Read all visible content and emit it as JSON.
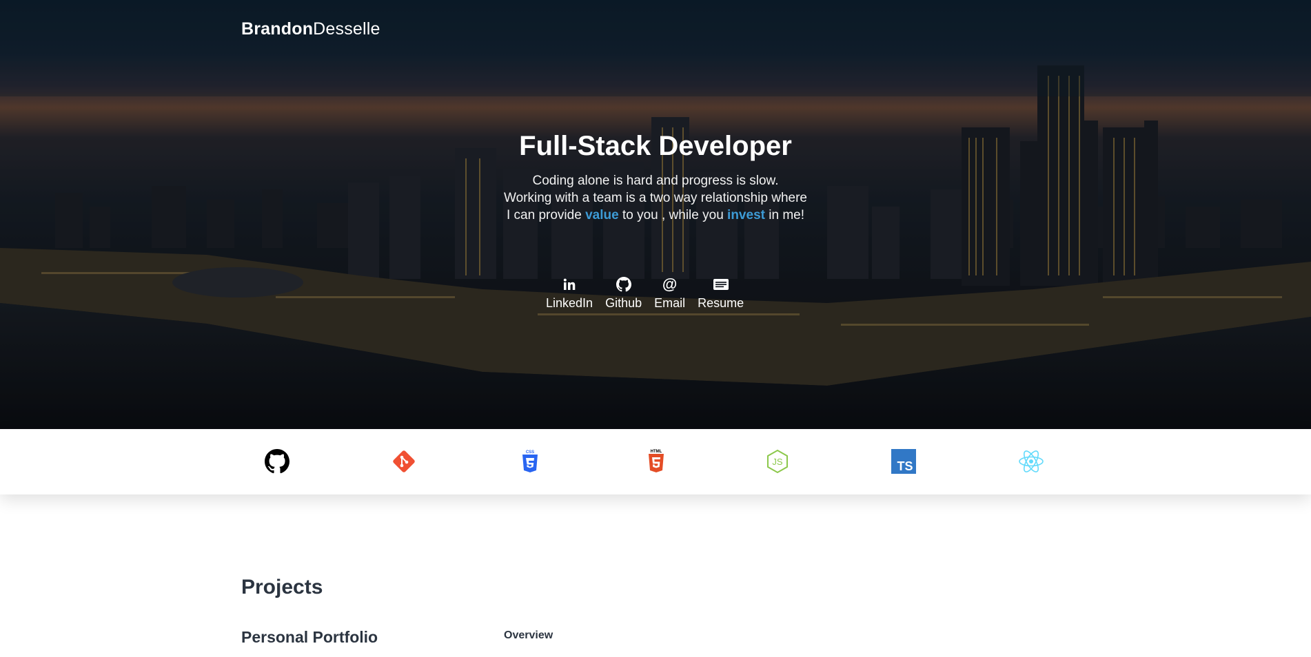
{
  "brand": {
    "first": "Brandon",
    "last": "Desselle"
  },
  "hero": {
    "headline": "Full-Stack Developer",
    "line1": "Coding alone is hard and progress is slow.",
    "line2": "Working with a team is a two way relationship where",
    "line3_a": "I can provide ",
    "line3_value": "value",
    "line3_b": " to you , while you ",
    "line3_invest": "invest",
    "line3_c": " in me!",
    "accent": "#3d9bd6"
  },
  "social": [
    {
      "label": "LinkedIn",
      "icon": "linkedin-icon"
    },
    {
      "label": "Github",
      "icon": "github-icon"
    },
    {
      "label": "Email",
      "icon": "at-icon"
    },
    {
      "label": "Resume",
      "icon": "resume-icon"
    }
  ],
  "tech": [
    {
      "icon": "github-icon",
      "color": "#000000"
    },
    {
      "icon": "git-icon",
      "color": "#f05033"
    },
    {
      "icon": "css3-icon",
      "color": "#2965f1"
    },
    {
      "icon": "html5-icon",
      "color": "#e44d26"
    },
    {
      "icon": "nodejs-icon",
      "color": "#8cc84b"
    },
    {
      "icon": "typescript-icon",
      "color": "#3178c6"
    },
    {
      "icon": "react-icon",
      "color": "#61dafb"
    }
  ],
  "tech_labels": {
    "css": "CSS",
    "html": "HTML",
    "js": "JS",
    "ts": "TS"
  },
  "projects": {
    "title": "Projects",
    "first_name": "Personal Portfolio",
    "overview_label": "Overview"
  }
}
